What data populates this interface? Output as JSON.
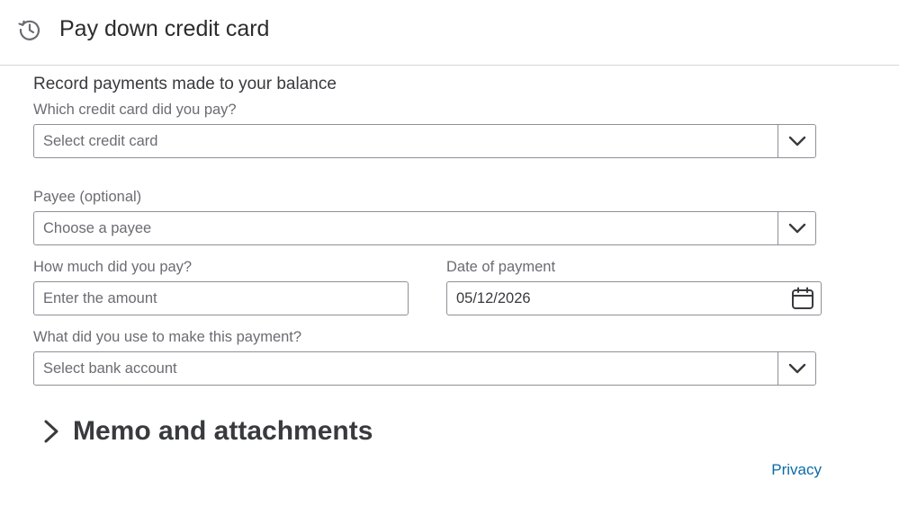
{
  "header": {
    "icon": "history-icon",
    "title": "Pay down credit card"
  },
  "form": {
    "section_title": "Record payments made to your balance",
    "credit_card": {
      "label": "Which credit card did you pay?",
      "placeholder": "Select credit card"
    },
    "payee": {
      "label": "Payee (optional)",
      "placeholder": "Choose a payee"
    },
    "amount": {
      "label": "How much did you pay?",
      "placeholder": "Enter the amount"
    },
    "date": {
      "label": "Date of payment",
      "value": "05/12/2026",
      "icon": "calendar-icon"
    },
    "bank_account": {
      "label": "What did you use to make this payment?",
      "placeholder": "Select bank account"
    }
  },
  "memo": {
    "label": "Memo and attachments",
    "icon": "chevron-right-icon"
  },
  "footer": {
    "privacy_label": "Privacy"
  },
  "colors": {
    "text": "#393a3d",
    "muted": "#6b6c72",
    "border": "#8d9096",
    "link": "#0d6ba6"
  }
}
